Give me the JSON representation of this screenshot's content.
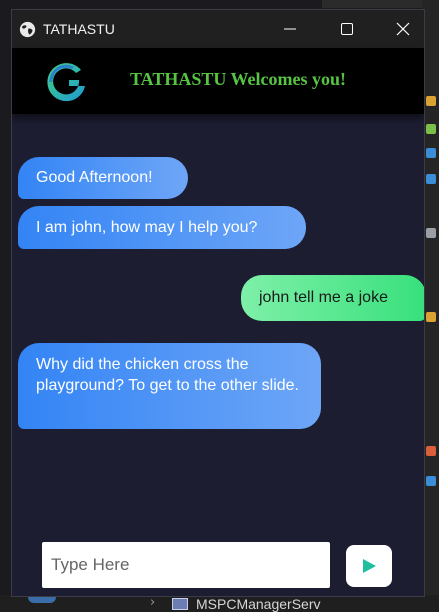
{
  "window": {
    "title": "TATHASTU",
    "controls": {
      "minimize": "minimize-icon",
      "maximize": "maximize-icon",
      "close": "close-icon"
    }
  },
  "header": {
    "welcome_text": "TATHASTU Welcomes you!",
    "logo": "tathastu-logo",
    "welcome_color": "#57c443"
  },
  "chat": {
    "messages": [
      {
        "from": "bot",
        "text": "Good Afternoon!"
      },
      {
        "from": "bot",
        "text": "I am john, how may I help you?"
      },
      {
        "from": "user",
        "text": "john tell me a joke"
      },
      {
        "from": "bot",
        "text": "Why did the chicken cross the playground? To get to the other slide."
      }
    ]
  },
  "composer": {
    "placeholder": "Type Here",
    "value": "",
    "send_icon": "send-icon"
  },
  "background": {
    "file_name": "MSPCManagerServ"
  },
  "colors": {
    "chat_bg": "#1c1d31",
    "bot_bubble_start": "#3384f5",
    "bot_bubble_end": "#6ea6f7",
    "user_bubble_start": "#7ef0a8",
    "user_bubble_end": "#38e07c",
    "send_icon": "#1fbf9f"
  }
}
